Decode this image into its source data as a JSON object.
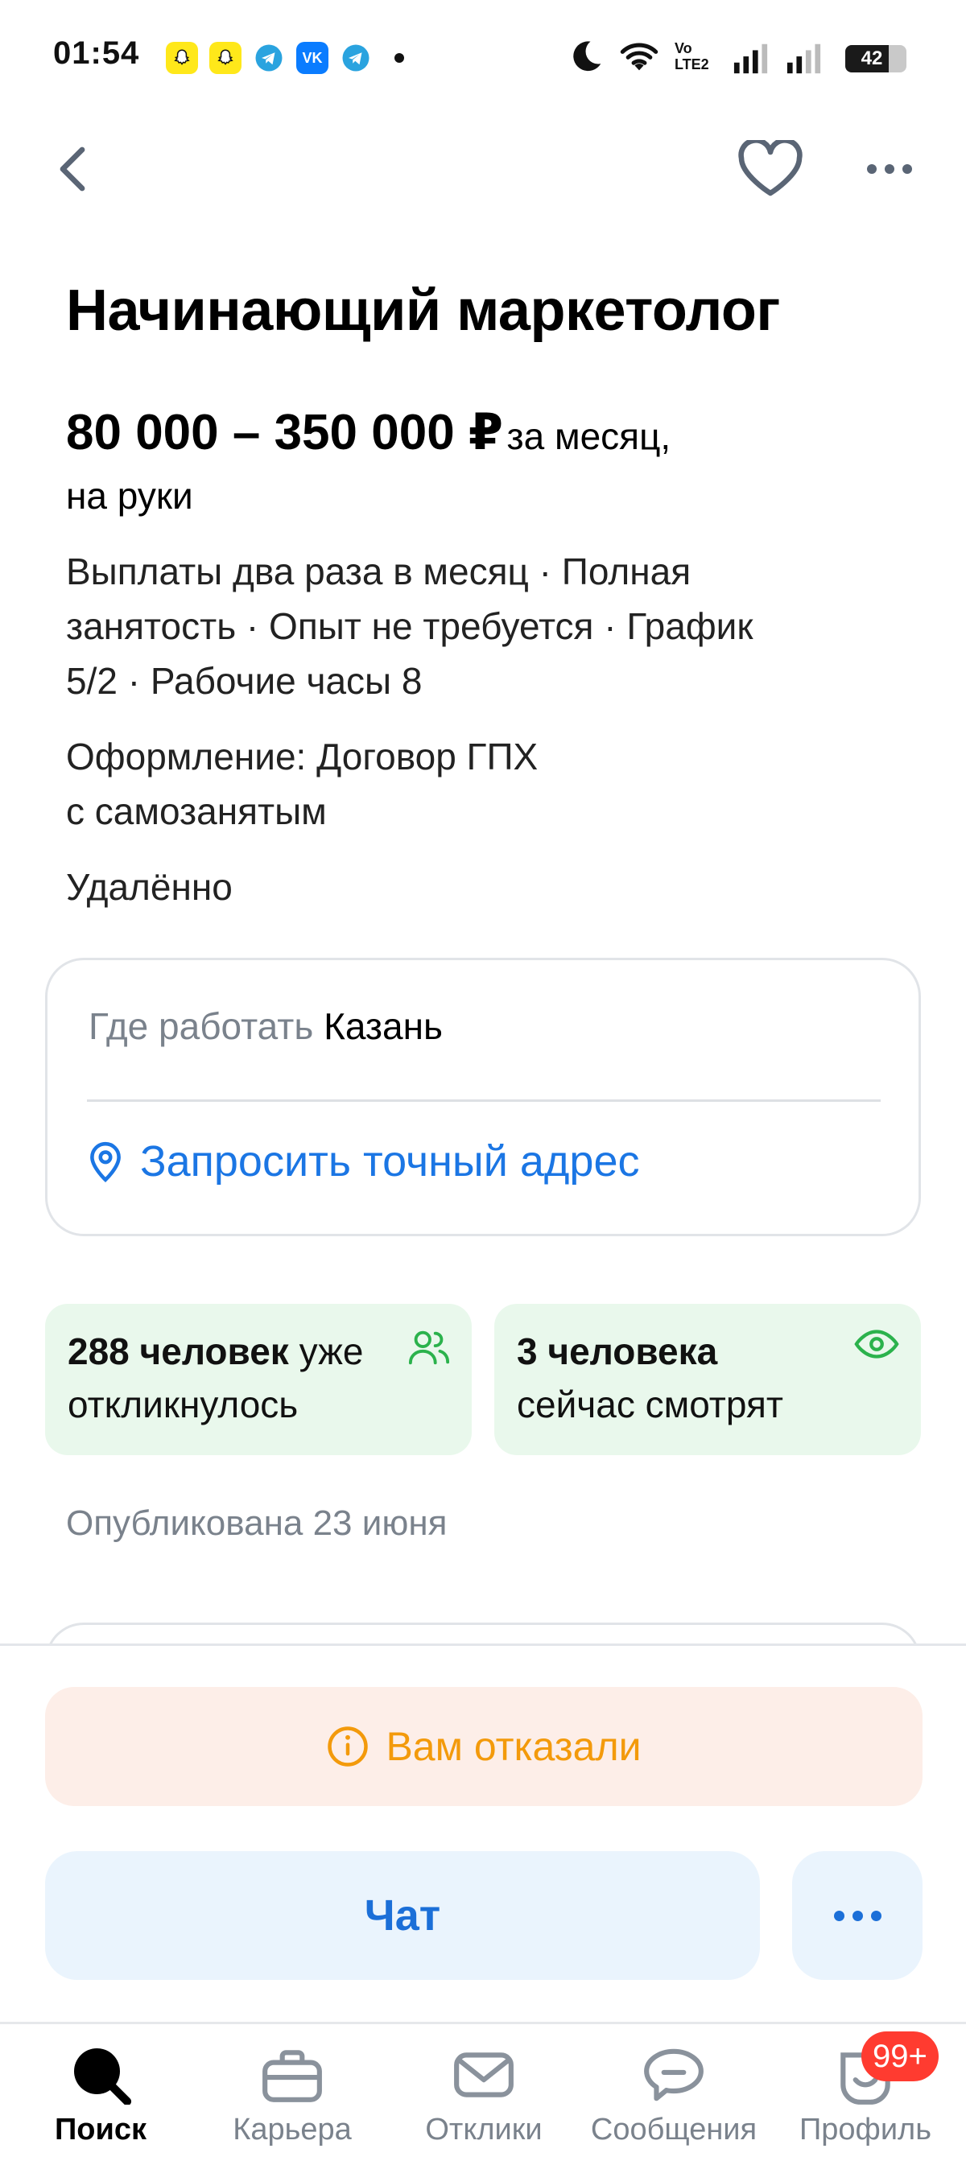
{
  "status_bar": {
    "time": "01:54",
    "battery": "42",
    "network_label": "Vo LTE2"
  },
  "header": {
    "back_icon": "chevron-left-icon",
    "favorite_icon": "heart-icon",
    "more_icon": "more-horizontal-icon"
  },
  "vacancy": {
    "title": "Начинающий маркетолог",
    "salary_amount": "80 000 – 350 000 ₽",
    "salary_period_1": "за месяц,",
    "salary_period_2": "на руки",
    "conditions_1": "Выплаты два раза в месяц · Полная",
    "conditions_2": "занятость · Опыт не требуется · График",
    "conditions_3": "5/2 · Рабочие часы 8",
    "employment_1": "Оформление: Договор ГПХ",
    "employment_2": "с самозанятым",
    "work_format": "Удалённо"
  },
  "location": {
    "where_label": "Где работать",
    "city": "Казань",
    "request_address": "Запросить точный адрес"
  },
  "stats": {
    "responded_count": "288 человек",
    "responded_suffix": "уже",
    "responded_line2": "откликнулось",
    "viewing_count": "3 человека",
    "viewing_line2": "сейчас смотрят"
  },
  "published": "Опубликована 23 июня",
  "actions": {
    "rejected": "Вам отказали",
    "chat": "Чат"
  },
  "nav": {
    "items": [
      {
        "label": "Поиск"
      },
      {
        "label": "Карьера"
      },
      {
        "label": "Отклики"
      },
      {
        "label": "Сообщения"
      },
      {
        "label": "Профиль"
      }
    ],
    "badge": "99+"
  },
  "colors": {
    "accent": "#1b76e4",
    "warning": "#f39a0b",
    "success_bg": "#e9f8ec",
    "success_icon": "#2bb24c",
    "badge": "#ff3b30"
  }
}
